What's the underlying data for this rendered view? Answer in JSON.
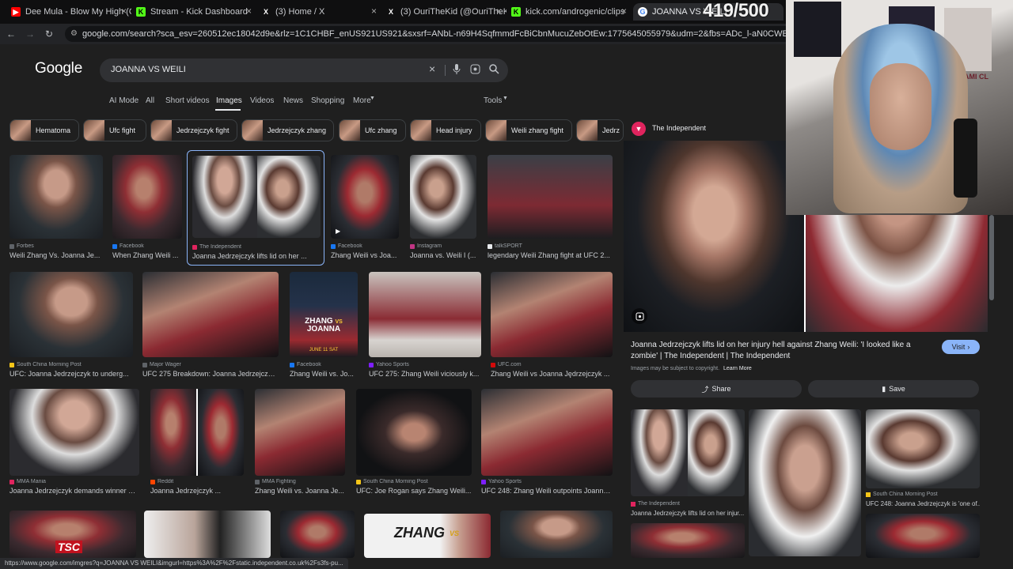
{
  "tabs": [
    {
      "title": "Dee Mula - Blow My High (Offi",
      "favicon": "youtube-icon",
      "color": "#ff0000"
    },
    {
      "title": "Stream - Kick Dashboard",
      "favicon": "kick-icon",
      "color": "#53fc18"
    },
    {
      "title": "(3) Home / X",
      "favicon": "x-icon",
      "color": "#ffffff"
    },
    {
      "title": "(3) OuriTheKid (@OuriTheKid) /",
      "favicon": "x-icon",
      "color": "#ffffff"
    },
    {
      "title": "kick.com/androgenic/clips",
      "favicon": "kick-icon",
      "color": "#53fc18"
    },
    {
      "title": "JOANNA VS WEILI",
      "favicon": "google-icon",
      "color": "#ffffff"
    }
  ],
  "counter": "419/500",
  "url": "google.com/search?sca_esv=260512ec18042d9e&rlz=1C1CHBF_enUS921US921&sxsrf=ANbL-n69H4SqfmmdFcBiCbnMucuZebOtEw:1775645055979&udm=2&fbs=ADc_l-aN0CWEZBOHjofHoaMMDiKpV6Bbbmx4QVa",
  "google": {
    "logo": "Google",
    "query": "JOANNA VS WEILI",
    "filters": [
      "AI Mode",
      "All",
      "Short videos",
      "Images",
      "Videos",
      "News",
      "Shopping",
      "More"
    ],
    "active_filter": "Images",
    "tools": "Tools"
  },
  "chips": [
    "Hematoma",
    "Ufc fight",
    "Jedrzejczyk fight",
    "Jedrzejczyk zhang",
    "Ufc zhang",
    "Head injury",
    "Weili zhang fight",
    "Jedrz"
  ],
  "grid": [
    {
      "source": "Forbes",
      "title": "Weili Zhang Vs. Joanna Je...",
      "dot": "#5f6368"
    },
    {
      "source": "Facebook",
      "title": "When Zhang Weili ...",
      "dot": "#1877f2"
    },
    {
      "source": "The Independent",
      "title": "Joanna Jedrzejczyk lifts lid on her ...",
      "dot": "#e0245e"
    },
    {
      "source": "Facebook",
      "title": "Zhang Weili vs Joa...",
      "dot": "#1877f2"
    },
    {
      "source": "Instagram",
      "title": "Joanna vs. Weili I (...",
      "dot": "#c13584"
    },
    {
      "source": "talkSPORT",
      "title": "legendary Weili Zhang fight at UFC 2...",
      "dot": "#e8eaed"
    },
    {
      "source": "South China Morning Post",
      "title": "UFC: Joanna Jedrzejczyk to underg...",
      "dot": "#f5c518"
    },
    {
      "source": "Major Wager",
      "title": "UFC 275 Breakdown: Joanna Jedrzejczyk...",
      "dot": "#5f6368"
    },
    {
      "source": "Facebook",
      "title": "Zhang Weili vs. Jo...",
      "dot": "#1877f2"
    },
    {
      "source": "Yahoo Sports",
      "title": "UFC 275: Zhang Weili viciously k...",
      "dot": "#7e1fff"
    },
    {
      "source": "UFC.com",
      "title": "Zhang Weili vs Joanna Jędrzejczyk ...",
      "dot": "#d20a0a"
    },
    {
      "source": "MMA Mania",
      "title": "Joanna Jedrzejczyk demands winner of...",
      "dot": "#e0245e"
    },
    {
      "source": "Reddit",
      "title": "Joanna Jedrzejczyk ...",
      "dot": "#ff4500"
    },
    {
      "source": "MMA Fighting",
      "title": "Zhang Weili vs. Joanna Je...",
      "dot": "#5f6368"
    },
    {
      "source": "South China Morning Post",
      "title": "UFC: Joe Rogan says Zhang Weili...",
      "dot": "#f5c518"
    },
    {
      "source": "Yahoo Sports",
      "title": "UFC 248: Zhang Weili outpoints Joanna...",
      "dot": "#7e1fff"
    }
  ],
  "poster": {
    "line1": "ZHANG",
    "line2": "JOANNA",
    "date": "JUNE 11 SAT",
    "vs": "VS"
  },
  "row4": {
    "tsc": "TSC",
    "zhang": "ZHANG",
    "vs": "VS"
  },
  "panel": {
    "source": "The Independent",
    "title": "Joanna Jedrzejczyk lifts lid on her injury hell against Zhang Weili: 'I looked like a zombie' | The Independent | The Independent",
    "visit": "Visit",
    "copyright": "Images may be subject to copyright.",
    "learn_more": "Learn More",
    "share": "Share",
    "save": "Save",
    "related": [
      {
        "source": "The Independent",
        "title": "Joanna Jedrzejczyk lifts lid on her injur..."
      },
      {
        "source": "South China Morning Post",
        "title": "UFC 248: Joanna Jedrzejczyk is 'one of..."
      }
    ]
  },
  "status_url": "https://www.google.com/imgres?q=JOANNA VS WEILI&imgurl=https%3A%2F%2Fstatic.independent.co.uk%2Fs3fs-pu...",
  "cam_sign": "MIAMI CL"
}
